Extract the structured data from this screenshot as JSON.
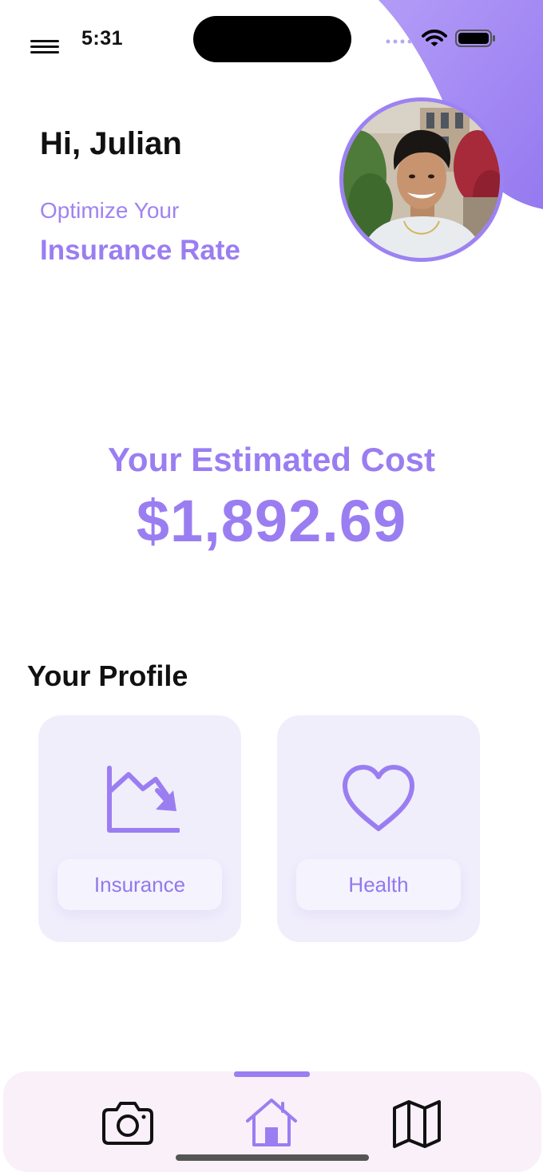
{
  "status_bar": {
    "time": "5:31"
  },
  "header": {
    "greeting": "Hi, Julian",
    "subtitle_line1": "Optimize Your",
    "subtitle_line2": "Insurance Rate"
  },
  "cost": {
    "label": "Your Estimated Cost",
    "value": "$1,892.69"
  },
  "profile": {
    "title": "Your Profile",
    "cards": [
      {
        "label": "Insurance",
        "icon": "trend-down-chart-icon"
      },
      {
        "label": "Health",
        "icon": "heart-icon"
      }
    ]
  },
  "tabbar": {
    "items": [
      {
        "name": "camera",
        "icon": "camera-icon",
        "selected": false
      },
      {
        "name": "home",
        "icon": "home-icon",
        "selected": true
      },
      {
        "name": "map",
        "icon": "map-icon",
        "selected": false
      }
    ]
  },
  "colors": {
    "accent": "#9a7ef1",
    "card_background": "#f1eefc",
    "tabbar_background": "#f9f0fa",
    "text": "#111111"
  }
}
